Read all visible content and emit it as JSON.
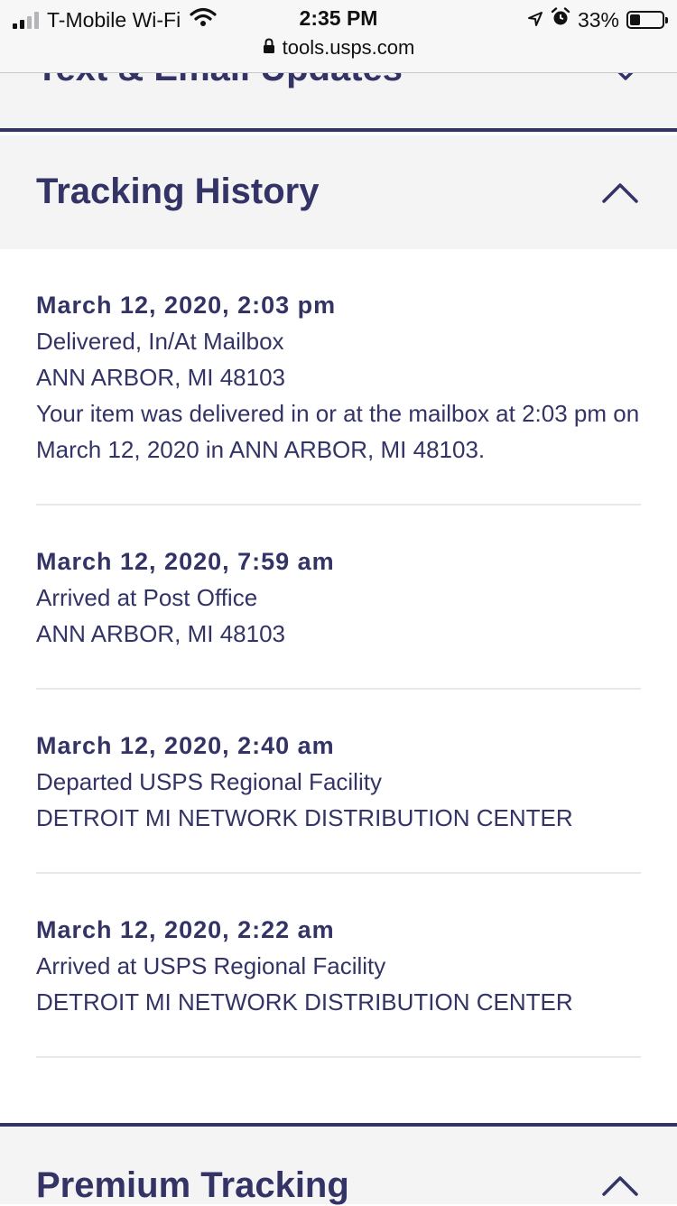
{
  "status_bar": {
    "carrier": "T-Mobile Wi-Fi",
    "time": "2:35 PM",
    "battery_percent": "33%",
    "battery_level": 0.33,
    "url": "tools.usps.com"
  },
  "sections": {
    "text_email": {
      "title": "Text & Email Updates"
    },
    "tracking_history": {
      "title": "Tracking History"
    },
    "premium_tracking": {
      "title": "Premium Tracking"
    }
  },
  "events": [
    {
      "date": "March 12, 2020, 2:03 pm",
      "status": "Delivered, In/At Mailbox",
      "location": "ANN ARBOR, MI 48103",
      "detail": "Your item was delivered in or at the mailbox at 2:03 pm on March 12, 2020 in ANN ARBOR, MI 48103."
    },
    {
      "date": "March 12, 2020, 7:59 am",
      "status": "Arrived at Post Office",
      "location": "ANN ARBOR, MI 48103"
    },
    {
      "date": "March 12, 2020, 2:40 am",
      "status": "Departed USPS Regional Facility",
      "location": "DETROIT MI NETWORK DISTRIBUTION CENTER"
    },
    {
      "date": "March 12, 2020, 2:22 am",
      "status": "Arrived at USPS Regional Facility",
      "location": "DETROIT MI NETWORK DISTRIBUTION CENTER"
    }
  ],
  "colors": {
    "brand_navy": "#333366",
    "header_bg": "#f4f4f5"
  }
}
